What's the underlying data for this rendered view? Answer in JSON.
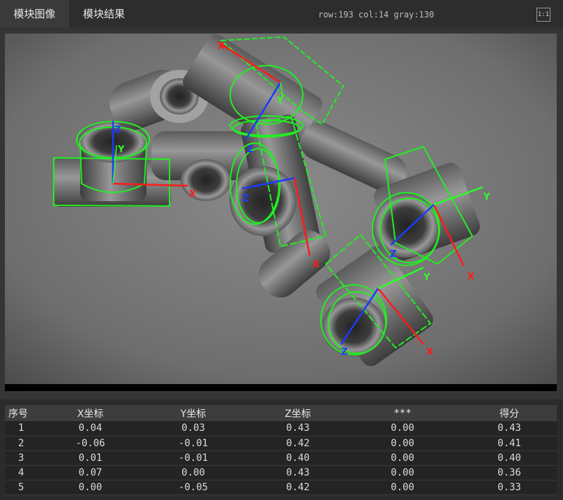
{
  "tabs": [
    {
      "label": "模块图像",
      "active": true
    },
    {
      "label": "模块结果",
      "active": false
    }
  ],
  "status": {
    "text": "row:193 col:14 gray:130"
  },
  "toolbar": {
    "fit_label": "1:1"
  },
  "axis_labels": {
    "x": "X",
    "y": "Y",
    "z": "Z"
  },
  "colors": {
    "x_axis": "#ff1a1a",
    "y_axis": "#2bff2b",
    "z_axis": "#1a3cff",
    "contour": "#22ee22"
  },
  "table": {
    "headers": [
      "序号",
      "X坐标",
      "Y坐标",
      "Z坐标",
      "***",
      "得分"
    ],
    "rows": [
      [
        "1",
        "0.04",
        "0.03",
        "0.43",
        "0.00",
        "0.43"
      ],
      [
        "2",
        "-0.06",
        "-0.01",
        "0.42",
        "0.00",
        "0.41"
      ],
      [
        "3",
        "0.01",
        "-0.01",
        "0.40",
        "0.00",
        "0.40"
      ],
      [
        "4",
        "0.07",
        "0.00",
        "0.43",
        "0.00",
        "0.36"
      ],
      [
        "5",
        "0.00",
        "-0.05",
        "0.42",
        "0.00",
        "0.33"
      ]
    ]
  }
}
